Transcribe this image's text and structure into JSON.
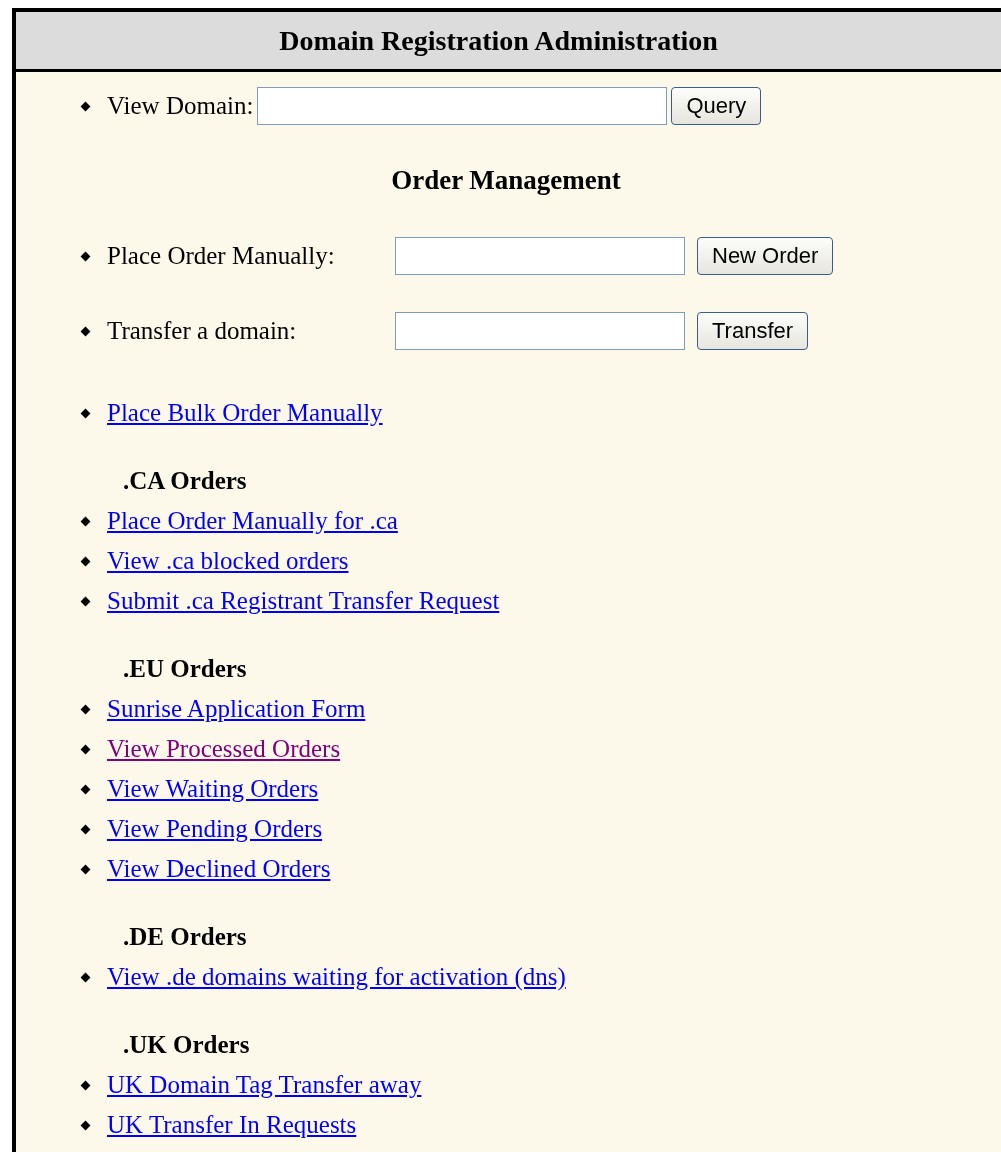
{
  "header": {
    "title": "Domain Registration Administration"
  },
  "view_domain": {
    "label": "View Domain:",
    "button": "Query"
  },
  "order_management": {
    "title": "Order Management",
    "forms": [
      {
        "label": "Place Order Manually:",
        "button": "New Order"
      },
      {
        "label": "Transfer a domain:",
        "button": "Transfer"
      }
    ],
    "links": [
      {
        "label": "Place Bulk Order Manually",
        "visited": false
      }
    ]
  },
  "sections": [
    {
      "title": ".CA Orders",
      "links": [
        {
          "label": "Place Order Manually for .ca",
          "visited": false
        },
        {
          "label": "View .ca blocked orders",
          "visited": false
        },
        {
          "label": "Submit .ca Registrant Transfer Request",
          "visited": false
        }
      ]
    },
    {
      "title": ".EU Orders",
      "links": [
        {
          "label": "Sunrise Application Form",
          "visited": false
        },
        {
          "label": "View Processed Orders",
          "visited": true
        },
        {
          "label": "View Waiting Orders",
          "visited": false
        },
        {
          "label": "View Pending Orders",
          "visited": false
        },
        {
          "label": "View Declined Orders",
          "visited": false
        }
      ]
    },
    {
      "title": ".DE Orders",
      "links": [
        {
          "label": "View .de domains waiting for activation (dns)",
          "visited": false
        }
      ]
    },
    {
      "title": ".UK Orders",
      "links": [
        {
          "label": "UK Domain Tag Transfer away",
          "visited": false
        },
        {
          "label": "UK Transfer In Requests",
          "visited": false
        }
      ]
    }
  ]
}
